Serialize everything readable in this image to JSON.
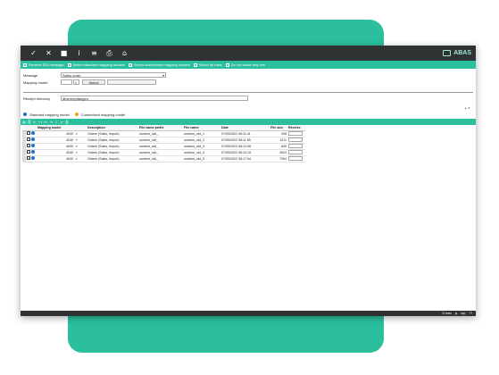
{
  "colors": {
    "accent": "#2bbf9e",
    "titlebar": "#2f3334",
    "standard_dot": "#1e6fd0",
    "customized_dot": "#f0a020"
  },
  "titlebar": {
    "icons": [
      "check-icon",
      "close-icon",
      "record-icon",
      "info-icon",
      "menu-icon",
      "print-icon",
      "home-icon"
    ],
    "glyphs": [
      "✓",
      "✕",
      "■",
      "i",
      "≡",
      "⎙",
      "⌂"
    ],
    "brand": "ABAS"
  },
  "actions": [
    {
      "label": "Receive EDI message"
    },
    {
      "label": "Select standard mapping models"
    },
    {
      "label": "Select customized mapping models"
    },
    {
      "label": "Select all rows"
    },
    {
      "label": "Do not select any row"
    }
  ],
  "form": {
    "message_label": "Message",
    "message_value": "Sales order",
    "mapping_label": "Mapping model",
    "select_label": "Select",
    "receipt_label": "Receipt directory",
    "receipt_value": "dfue/empfangen"
  },
  "legend": {
    "standard": "Standard mapping model",
    "customized": "Customized mapping model"
  },
  "table": {
    "columns": [
      "Mapping model",
      "",
      "Description",
      "File name prefix",
      "File name",
      "Date",
      "File size",
      "Receive"
    ],
    "rows": [
      {
        "model": "4040",
        "desc": "Orders (Sales, Import)",
        "prefix": "oorders_std_",
        "file": "oorders_std_1",
        "date": "07/05/2022 08:11:41",
        "size": "408"
      },
      {
        "model": "4040",
        "desc": "Orders (Sales, Import)",
        "prefix": "oorders_std_",
        "file": "oorders_std_2",
        "date": "07/05/2022 08:11:55",
        "size": "1011"
      },
      {
        "model": "4040",
        "desc": "Orders (Sales, Import)",
        "prefix": "oorders_std_",
        "file": "oorders_std_3",
        "date": "07/05/2022 08:12:08",
        "size": "830"
      },
      {
        "model": "4040",
        "desc": "Orders (Sales, Import)",
        "prefix": "oorders_std_",
        "file": "oorders_std_4",
        "date": "07/05/2022 08:12:15",
        "size": "2624"
      },
      {
        "model": "4040",
        "desc": "Orders (Sales, Import)",
        "prefix": "oorders_std_",
        "file": "oorders_std_5",
        "date": "07/05/2022 08:17:04",
        "size": "7904"
      }
    ]
  },
  "statusbar": [
    "5 Lines",
    "ja",
    "esp",
    "??"
  ]
}
